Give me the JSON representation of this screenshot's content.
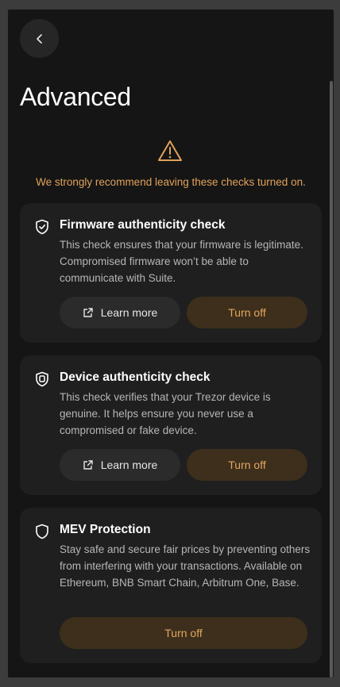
{
  "header": {
    "back_icon": "chevron-left-icon",
    "title": "Advanced"
  },
  "warning": {
    "icon": "warning-triangle-icon",
    "text": "We strongly recommend leaving these checks turned on.",
    "color": "#e0a25b"
  },
  "cards": [
    {
      "icon": "shield-check-icon",
      "title": "Firmware authenticity check",
      "description": "This check ensures that your firmware is legitimate. Compromised firmware won’t be able to communicate with Suite.",
      "learn_more_icon": "external-link-icon",
      "learn_more_label": "Learn more",
      "turn_off_label": "Turn off"
    },
    {
      "icon": "device-shield-icon",
      "title": "Device authenticity check",
      "description": "This check verifies that your Trezor device is genuine. It helps ensure you never use a compromised or fake device.",
      "learn_more_icon": "external-link-icon",
      "learn_more_label": "Learn more",
      "turn_off_label": "Turn off"
    },
    {
      "icon": "shield-icon",
      "title": "MEV Protection",
      "description": "Stay safe and secure fair prices by preventing others from interfering with your transactions. Available on Ethereum, BNB Smart Chain, Arbitrum One, Base.",
      "turn_off_label": "Turn off"
    }
  ],
  "colors": {
    "accent": "#e3a75e",
    "accent_button_bg": "#3d2f1c",
    "card_bg": "#1f1f1f",
    "page_bg": "#151515"
  }
}
